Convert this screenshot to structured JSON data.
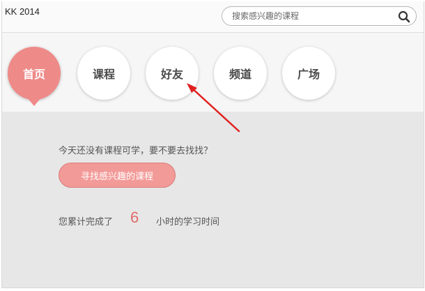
{
  "app": {
    "title": "KK 2014"
  },
  "search": {
    "placeholder": "搜索感兴趣的课程"
  },
  "nav": {
    "items": [
      {
        "label": "首页"
      },
      {
        "label": "课程"
      },
      {
        "label": "好友"
      },
      {
        "label": "频道"
      },
      {
        "label": "广场"
      }
    ]
  },
  "main": {
    "prompt": "今天还没有课程可学，要不要去找找？",
    "find_button_label": "寻找感兴趣的课程",
    "stats": {
      "prefix": "您累计完成了",
      "hours": "6",
      "suffix": "小时的学习时间"
    }
  },
  "colors": {
    "accent": "#ee8a88",
    "button": "#f29a98",
    "highlight_number": "#e46a6a",
    "annotation_arrow": "#e02020"
  },
  "icons": {
    "search": "search-icon"
  }
}
